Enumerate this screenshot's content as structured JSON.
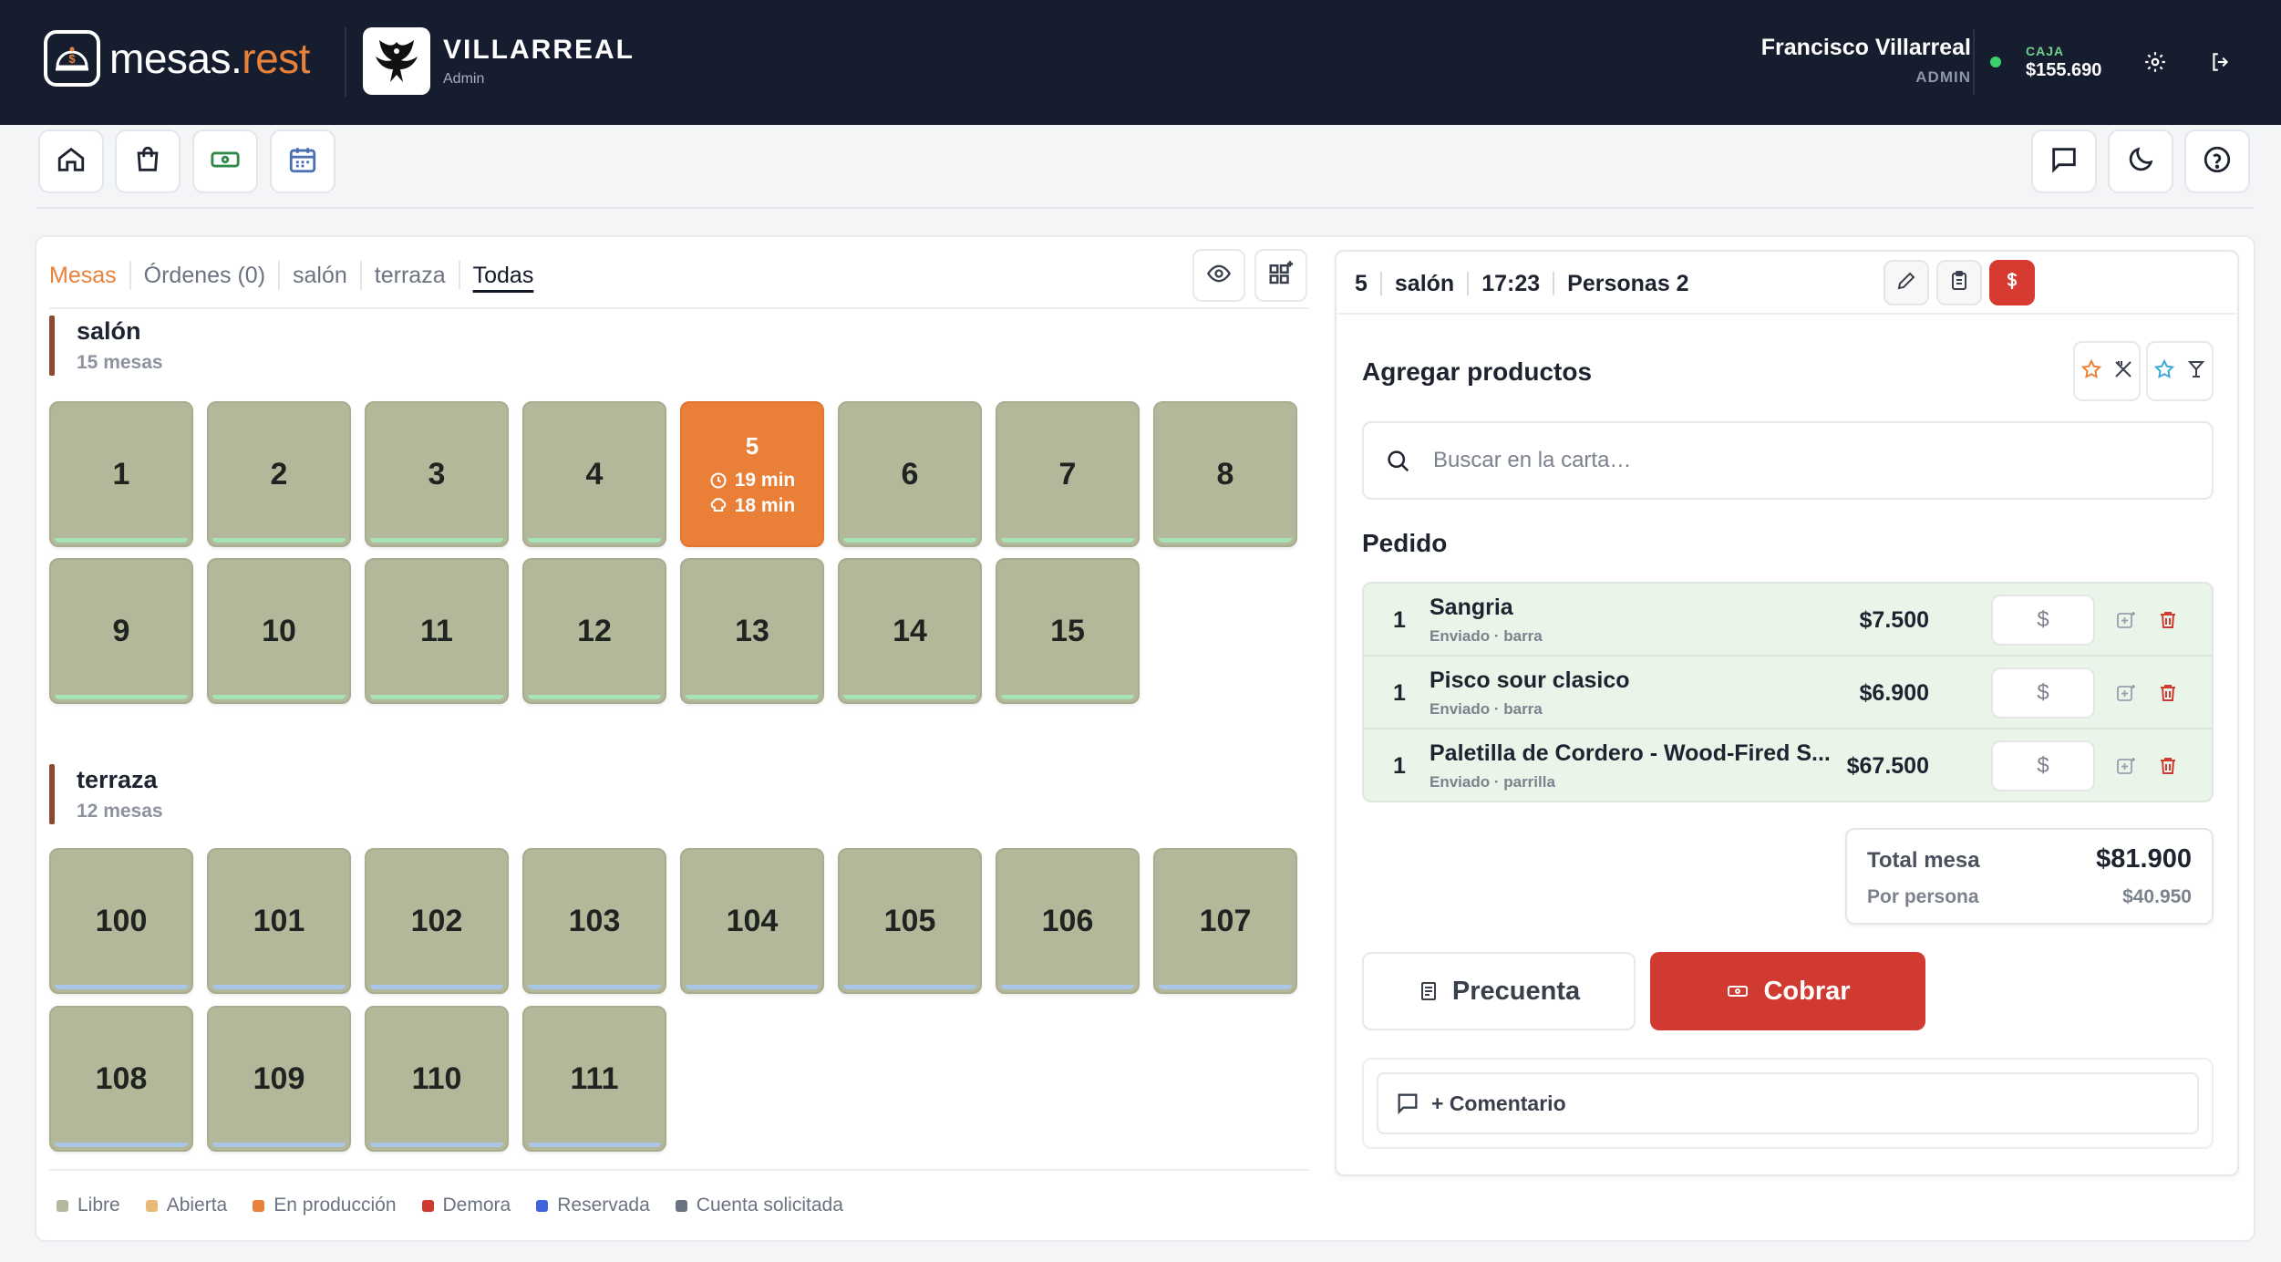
{
  "header": {
    "brand_main": "mesas.",
    "brand_accent": "rest",
    "venue_name": "VILLARREAL",
    "venue_role": "Admin",
    "user_name": "Francisco Villarreal",
    "user_role": "ADMIN",
    "caja_label": "CAJA",
    "caja_amount": "$155.690"
  },
  "tabs": [
    {
      "label": "Mesas"
    },
    {
      "label": "Órdenes (0)"
    },
    {
      "label": "salón"
    },
    {
      "label": "terraza"
    },
    {
      "label": "Todas"
    }
  ],
  "sections": [
    {
      "title": "salón",
      "subtitle": "15 mesas",
      "tables": [
        "1",
        "2",
        "3",
        "4",
        "5",
        "6",
        "7",
        "8",
        "9",
        "10",
        "11",
        "12",
        "13",
        "14",
        "15"
      ]
    },
    {
      "title": "terraza",
      "subtitle": "12 mesas",
      "tables": [
        "100",
        "101",
        "102",
        "103",
        "104",
        "105",
        "106",
        "107",
        "108",
        "109",
        "110",
        "111"
      ]
    }
  ],
  "active_table": {
    "number": "5",
    "time_elapsed": "19 min",
    "kitchen_time": "18 min"
  },
  "legend": [
    {
      "label": "Libre",
      "color": "#b4b89a"
    },
    {
      "label": "Abierta",
      "color": "#eab877"
    },
    {
      "label": "En producción",
      "color": "#e8813a"
    },
    {
      "label": "Demora",
      "color": "#cf3a30"
    },
    {
      "label": "Reservada",
      "color": "#3e63dd"
    },
    {
      "label": "Cuenta solicitada",
      "color": "#6b7280"
    }
  ],
  "order": {
    "table": "5",
    "area": "salón",
    "time": "17:23",
    "people": "Personas 2",
    "add_products_title": "Agregar productos",
    "search_placeholder": "Buscar en la carta…",
    "pedido_title": "Pedido",
    "items": [
      {
        "qty": "1",
        "name": "Sangria",
        "status": "Enviado · barra",
        "price": "$7.500",
        "pay": "$"
      },
      {
        "qty": "1",
        "name": "Pisco sour clasico",
        "status": "Enviado · barra",
        "price": "$6.900",
        "pay": "$"
      },
      {
        "qty": "1",
        "name": "Paletilla de Cordero - Wood-Fired S...",
        "status": "Enviado · parrilla",
        "price": "$67.500",
        "pay": "$"
      }
    ],
    "total_label": "Total mesa",
    "total_amount": "$81.900",
    "per_person_label": "Por persona",
    "per_person_amount": "$40.950",
    "precuenta_label": "Precuenta",
    "cobrar_label": "Cobrar",
    "comment_label": "+ Comentario"
  },
  "colors": {
    "header_bg": "#161d2f",
    "accent_orange": "#e8813a",
    "table_free": "#b4b89a",
    "danger_red": "#d03a30",
    "ordered_bg": "#eaf5ea"
  }
}
